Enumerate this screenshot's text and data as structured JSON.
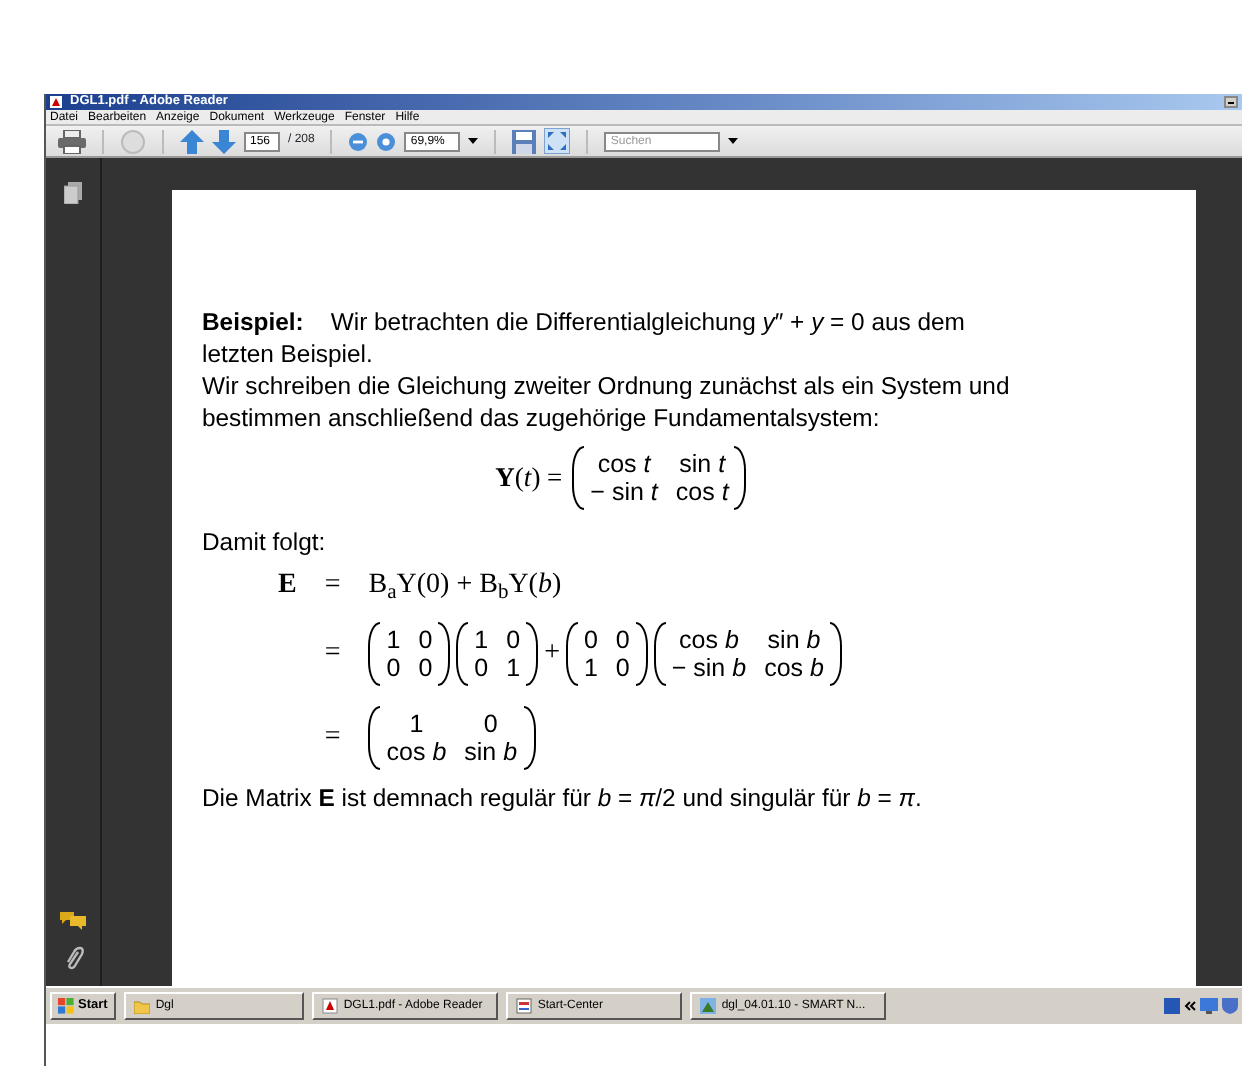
{
  "window": {
    "title": "DGL1.pdf - Adobe Reader"
  },
  "menu": [
    "Datei",
    "Bearbeiten",
    "Anzeige",
    "Dokument",
    "Werkzeuge",
    "Fenster",
    "Hilfe"
  ],
  "toolbar": {
    "page": "156",
    "page_count": "/ 208",
    "zoom": "69,9%",
    "search": {
      "placeholder": "Suchen"
    }
  },
  "document": {
    "blocks": [
      {
        "kind": "paragraph",
        "text": "**Beispiel:**    Wir betrachten die Differentialgleichung *y*″ + *y* = 0 aus dem letzten Beispiel."
      },
      {
        "kind": "paragraph",
        "text": "Wir schreiben die Gleichung zweiter Ordnung zunächst als ein System und bestimmen anschließend das zugehörige Fundamentalsystem:"
      },
      {
        "kind": "display",
        "items": [
          {
            "kind": "text",
            "text": "**Y**(*t*) ="
          },
          {
            "kind": "matrix",
            "rows": [
              [
                "cos *t*",
                "sin *t*"
              ],
              [
                "− sin *t*",
                "cos *t*"
              ]
            ]
          }
        ]
      },
      {
        "kind": "paragraph",
        "text": "Damit folgt:"
      },
      {
        "kind": "align",
        "rows": [
          {
            "lhs": "**E**",
            "rel": "=",
            "items": [
              {
                "kind": "text",
                "text": "B$_{a}$Y(0) + B$_{b}$Y(*b*)"
              }
            ]
          },
          {
            "lhs": "",
            "rel": "=",
            "items": [
              {
                "kind": "matrix",
                "rows": [
                  [
                    "1",
                    "0"
                  ],
                  [
                    "0",
                    "0"
                  ]
                ]
              },
              {
                "kind": "matrix",
                "rows": [
                  [
                    "1",
                    "0"
                  ],
                  [
                    "0",
                    "1"
                  ]
                ]
              },
              {
                "kind": "text",
                "text": "+"
              },
              {
                "kind": "matrix",
                "rows": [
                  [
                    "0",
                    "0"
                  ],
                  [
                    "1",
                    "0"
                  ]
                ]
              },
              {
                "kind": "matrix",
                "rows": [
                  [
                    "cos *b*",
                    "sin *b*"
                  ],
                  [
                    "− sin *b*",
                    "cos *b*"
                  ]
                ]
              }
            ]
          },
          {
            "lhs": "",
            "rel": "=",
            "items": [
              {
                "kind": "matrix",
                "rows": [
                  [
                    "1",
                    "0"
                  ],
                  [
                    "cos *b*",
                    "sin *b*"
                  ]
                ]
              }
            ]
          }
        ]
      },
      {
        "kind": "paragraph",
        "text": "Die Matrix **E** ist demnach regulär für *b* = *π*/2 und singulär für *b* = *π*."
      }
    ]
  },
  "taskbar": {
    "start": "Start",
    "tasks": [
      {
        "label": "Dgl",
        "kind": "folder"
      },
      {
        "label": "DGL1.pdf - Adobe Reader",
        "kind": "pdf"
      },
      {
        "label": "Start-Center",
        "kind": "office"
      },
      {
        "label": "dgl_04.01.10 - SMART N...",
        "kind": "smart"
      }
    ]
  }
}
